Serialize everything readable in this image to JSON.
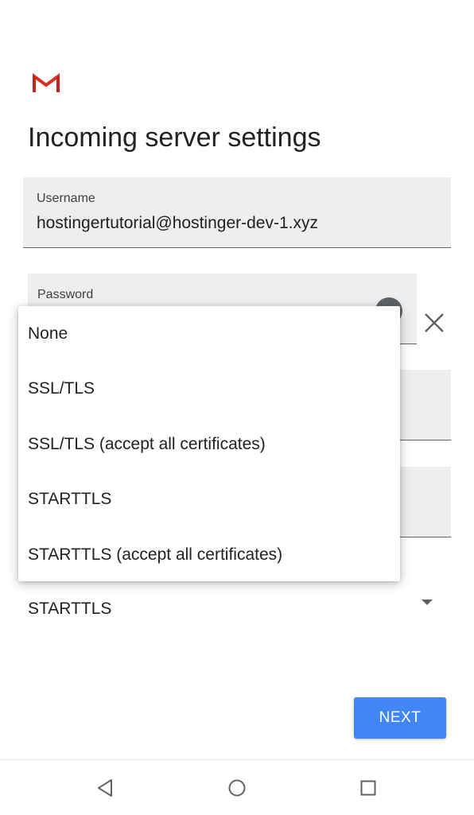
{
  "app": {
    "logo_icon": "gmail-logo-icon",
    "brand_color": "#d93025"
  },
  "header": {
    "title": "Incoming server settings"
  },
  "form": {
    "username": {
      "label": "Username",
      "value": "hostingertutorial@hostinger-dev-1.xyz"
    },
    "password": {
      "label": "Password"
    },
    "security_type": {
      "selected": "STARTTLS"
    }
  },
  "security_menu": {
    "options": [
      "None",
      "SSL/TLS",
      "SSL/TLS (accept all certificates)",
      "STARTTLS",
      "STARTTLS (accept all certificates)"
    ]
  },
  "actions": {
    "next_label": "NEXT",
    "next_color": "#4285f4"
  },
  "nav_bar": {
    "back_icon": "back-triangle-icon",
    "home_icon": "home-circle-icon",
    "recents_icon": "recents-square-icon"
  }
}
